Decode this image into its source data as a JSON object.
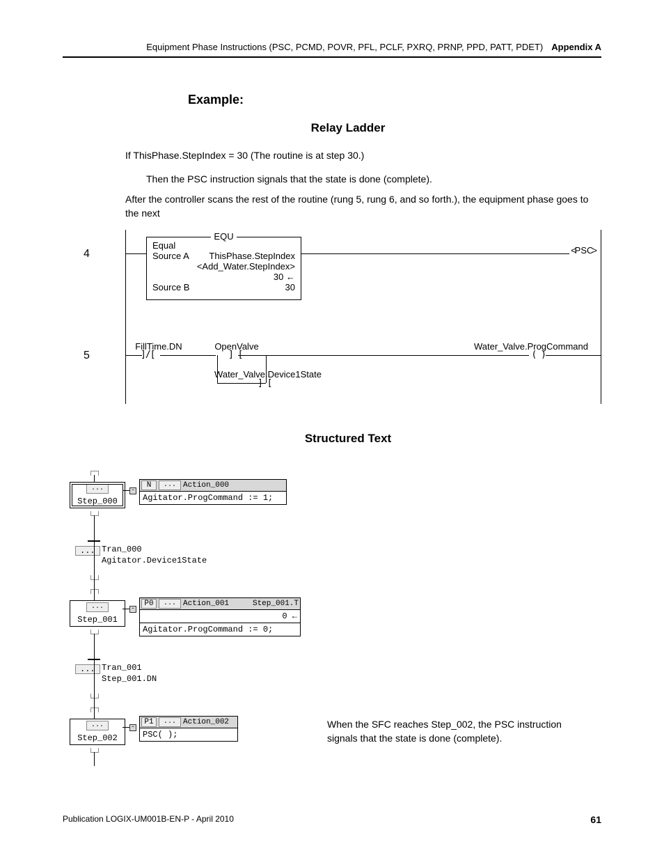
{
  "header": {
    "chapter_title": "Equipment Phase Instructions (PSC, PCMD, POVR, PFL, PCLF, PXRQ, PRNP, PPD, PATT, PDET)",
    "appendix": "Appendix A"
  },
  "example_heading": "Example:",
  "sub_relay": "Relay Ladder",
  "body1": "If ThisPhase.StepIndex = 30 (The routine is at step 30.)",
  "body2": "Then the PSC instruction signals that the state is done (complete).",
  "body3": "After the controller scans the rest of the routine (rung 5, rung 6, and so forth.), the equipment phase goes to the next",
  "ladder": {
    "rung4": "4",
    "rung5": "5",
    "equ_title": "EQU",
    "equ_equal": "Equal",
    "equ_srcA_l": "Source A",
    "equ_srcA_r": "ThisPhase.StepIndex",
    "equ_hint": "<Add_Water.StepIndex>",
    "equ_30a": "30",
    "equ_srcB_l": "Source B",
    "equ_srcB_r": "30",
    "psc": "PSC",
    "fill": "FillTime.DN",
    "open": "OpenValve",
    "water_state": "Water_Valve.Device1State",
    "water_prog": "Water_Valve.ProgCommand"
  },
  "sub_structured": "Structured Text",
  "sfc": {
    "step0": "Step_000",
    "act0_q": "N",
    "act0_name": "Action_000",
    "act0_body": "Agitator.ProgCommand := 1;",
    "tran0": "Tran_000",
    "tran0_cond": "Agitator.Device1State",
    "step1": "Step_001",
    "act1_q": "P0",
    "act1_name": "Action_001",
    "act1_t": "Step_001.T",
    "act1_zero": "0",
    "act1_body": "Agitator.ProgCommand := 0;",
    "tran1": "Tran_001",
    "tran1_cond": "Step_001.DN",
    "step2": "Step_002",
    "act2_q": "P1",
    "act2_name": "Action_002",
    "act2_body": "PSC( );"
  },
  "sfc_caption": "When the SFC reaches Step_002, the PSC instruction signals that the state is done (complete).",
  "footer": {
    "pub": "Publication LOGIX-UM001B-EN-P - April 2010",
    "page": "61"
  }
}
